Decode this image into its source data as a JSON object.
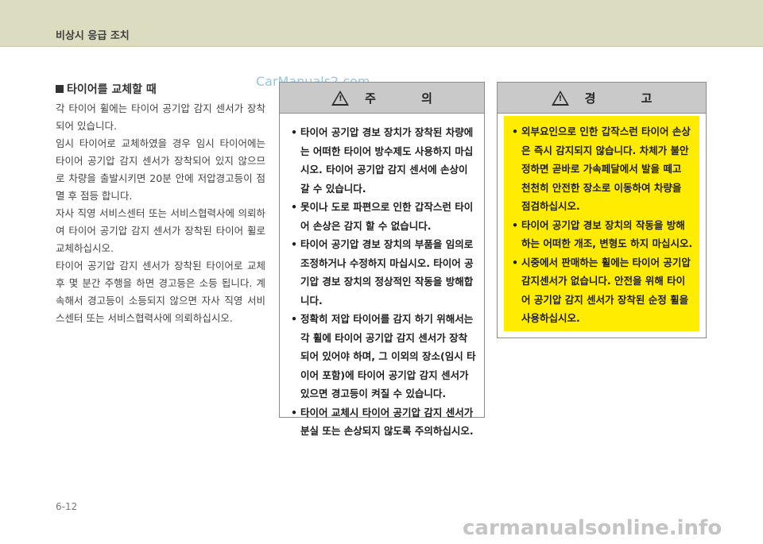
{
  "header": {
    "title": "비상시 응급 조치"
  },
  "watermark_top": "CarManuals2.com",
  "section": {
    "title": "타이어를 교체할 때",
    "paragraphs": [
      "각 타이어 휠에는 타이어 공기압 감지 센서가 장착되어 있습니다.",
      "임시 타이어로 교체하였을 경우 임시 타이어에는 타이어 공기압 감지 센서가 장착되어 있지 않으므로 차량을 출발시키면 20분 안에 저압경고등이 점멸 후 점등 합니다.",
      "자사 직영 서비스센터 또는 서비스협력사에 의뢰하여 타이어 공기압 감지 센서가 장착된 타이어 휠로 교체하십시오.",
      "타이어 공기압 감지 센서가 장착된 타이어로 교체 후 몇 분간 주행을 하면 경고등은 소등 됩니다. 계속해서 경고등이 소등되지 않으면 자사 직영 서비스센터 또는 서비스협력사에 의뢰하십시오."
    ]
  },
  "caution": {
    "title": "주 의",
    "items": [
      "타이어 공기압 경보 장치가 장착된 차량에는 어떠한 타이어 방수제도 사용하지 마십시오. 타이어 공기압 감지 센서에 손상이 갈 수 있습니다.",
      "못이나 도로 파편으로 인한 갑작스런 타이어 손상은 감지 할 수 없습니다.",
      "타이어 공기압 경보 장치의 부품을 임의로 조정하거나 수정하지 마십시오. 타이어 공기압 경보 장치의 정상적인 작동을 방해합니다.",
      "정확히 저압 타이어를 감지 하기 위해서는 각 휠에 타이어 공기압 감지 센서가 장착되어 있어야 하며, 그 이외의 장소(임시 타이어 포함)에 타이어 공기압 감지 센서가 있으면 경고등이 켜질 수 있습니다.",
      "타이어 교체시 타이어 공기압 감지 센서가 분실 또는 손상되지 않도록 주의하십시오."
    ]
  },
  "warning": {
    "title": "경 고",
    "items": [
      "외부요인으로 인한 갑작스런 타이어 손상은 즉시 감지되지 않습니다. 차체가 불안정하면 곧바로 가속페달에서 발을 떼고 천천히 안전한 장소로 이동하여 차량을 점검하십시오.",
      "타이어 공기압 경보 장치의 작동을 방해하는 어떠한 개조, 변형도 하지 마십시오.",
      "시중에서 판매하는 휠에는 타이어 공기압 감지센서가 없습니다. 안전을 위해 타이어 공기압 감지 센서가 장착된 순정 휠을 사용하십시오."
    ]
  },
  "page_number": "6-12",
  "watermark_bottom": "carmanualsonline.info",
  "colors": {
    "header": "#dcdcc0",
    "warning_fill": "#ffec00",
    "box_head": "#c9c9c9"
  },
  "icons": {
    "caution": "warning-triangle-icon",
    "warning": "warning-triangle-icon"
  }
}
